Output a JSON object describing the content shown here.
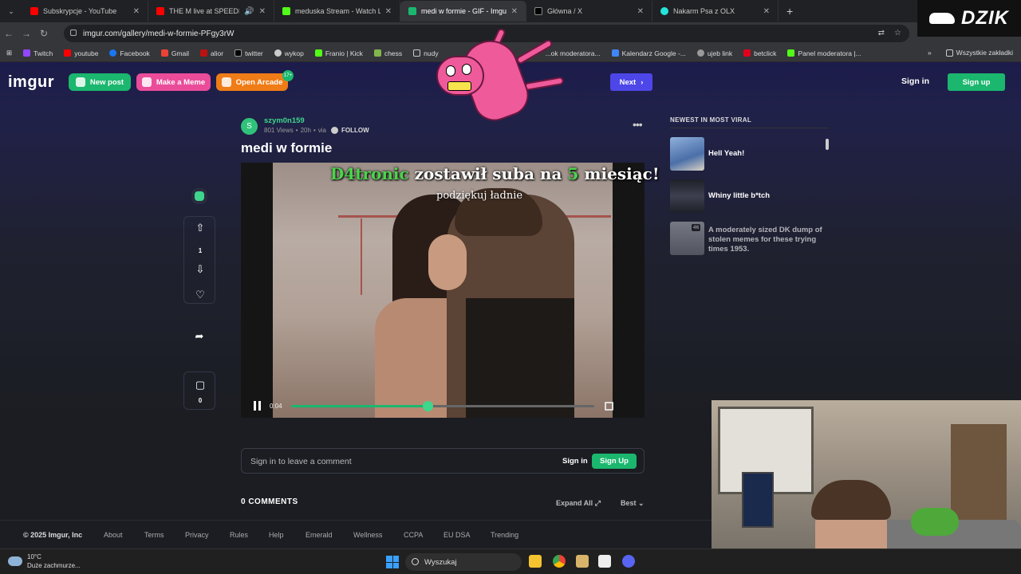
{
  "browser": {
    "tabs": [
      {
        "title": "Subskrypcje - YouTube",
        "color": "#ff0000",
        "active": false
      },
      {
        "title": "THE M live at SPEEDLAND",
        "color": "#ff0000",
        "active": false
      },
      {
        "title": "meduska Stream - Watch Live",
        "color": "#53fc18",
        "active": false
      },
      {
        "title": "medi w formie - GIF - Imgur",
        "color": "#1bb76e",
        "active": true
      },
      {
        "title": "Główna / X",
        "color": "#ffffff",
        "active": false
      },
      {
        "title": "Nakarm Psa z OLX",
        "color": "#23e5db",
        "active": false
      }
    ],
    "url": "imgur.com/gallery/medi-w-formie-PFgy3rW",
    "bookmarks": [
      "Twitch",
      "youtube",
      "Facebook",
      "Gmail",
      "alior",
      "twitter",
      "wykop",
      "Franio | Kick",
      "chess",
      "nudy",
      "Kalendarz Google -...",
      "ujeb link",
      "betclick",
      "Panel moderatora |..."
    ],
    "bookmarks_partial": "...ok moderatora...",
    "bookmarks_all": "Wszystkie zakładki"
  },
  "overlay_brand": "DZIK",
  "imgur": {
    "logo": "imgur",
    "new_post": "New post",
    "make_meme": "Make a Meme",
    "open_arcade": "Open Arcade",
    "arcade_badge": "17+",
    "next": "Next",
    "sign_in": "Sign in",
    "sign_up": "Sign up"
  },
  "post": {
    "avatar_letter": "S",
    "username": "szym0n159",
    "views": "801 Views",
    "age": "20h",
    "via": "via",
    "follow": "FOLLOW",
    "title": "medi w formie",
    "vote_count": "1",
    "comment_count": "0",
    "video_overlay_user": "D4tronic",
    "video_overlay_mid": "zostawił suba na",
    "video_overlay_num": "5",
    "video_overlay_end": "miesiąc!",
    "video_overlay_sub": "podziękuj ładnie",
    "current_time": "0:04",
    "progress": 0.45
  },
  "comments": {
    "placeholder": "Sign in to leave a comment",
    "sign_in": "Sign in",
    "sign_up": "Sign Up",
    "count_label": "0 COMMENTS",
    "expand_all": "Expand All",
    "sort": "Best"
  },
  "newest": {
    "heading": "NEWEST IN MOST VIRAL",
    "items": [
      {
        "title": "Hell Yeah!",
        "thumb": "#6a8fc8"
      },
      {
        "title": "Whiny little b*tch",
        "thumb": "#2e3140"
      },
      {
        "title": "A moderately sized DK dump of stolen memes for these trying times 1953.",
        "thumb": "#8a8e96",
        "badge": "46"
      }
    ]
  },
  "footer": {
    "copyright": "© 2025 Imgur, Inc",
    "links": [
      "About",
      "Terms",
      "Privacy",
      "Rules",
      "Help",
      "Emerald",
      "Wellness",
      "CCPA",
      "EU DSA",
      "Trending"
    ]
  },
  "taskbar": {
    "temp": "10°C",
    "weather": "Duże zachmurze...",
    "search": "Wyszukaj"
  }
}
